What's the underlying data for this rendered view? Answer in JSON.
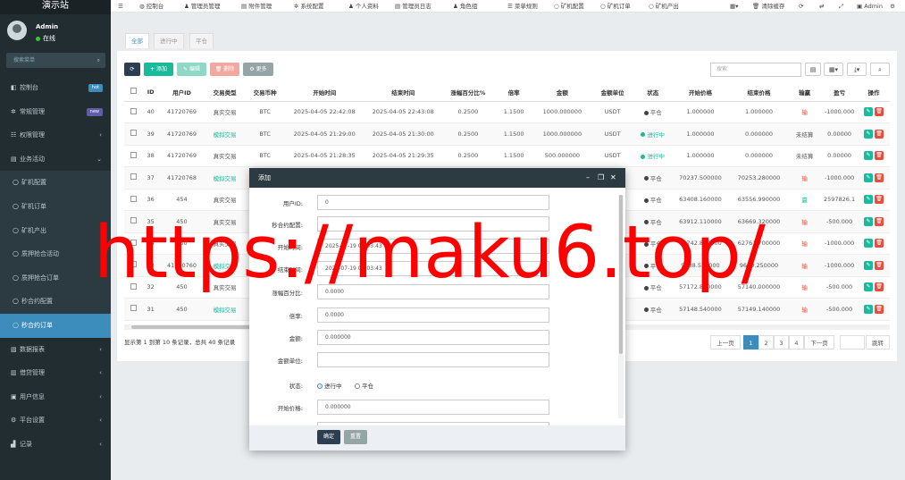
{
  "sidebar": {
    "brand": "演示站",
    "user": {
      "name": "Admin",
      "status": "在线"
    },
    "search_placeholder": "搜索菜单",
    "menu": [
      {
        "label": "控制台",
        "icon": "dashboard-icon",
        "badge": "hot"
      },
      {
        "label": "常规管理",
        "icon": "cog-icon",
        "badge": "new"
      },
      {
        "label": "权限管理",
        "icon": "group-icon",
        "chev": "‹"
      },
      {
        "label": "业务活动",
        "icon": "list-icon",
        "chev": "⌄"
      },
      {
        "label": "矿机配置",
        "icon": "circle-icon",
        "sub": true
      },
      {
        "label": "矿机订单",
        "icon": "circle-icon",
        "sub": true
      },
      {
        "label": "矿机产出",
        "icon": "circle-icon",
        "sub": true
      },
      {
        "label": "质押抢合活动",
        "icon": "circle-icon",
        "sub": true
      },
      {
        "label": "质押抢合订单",
        "icon": "circle-icon",
        "sub": true
      },
      {
        "label": "秒合约配置",
        "icon": "circle-icon",
        "sub": true
      },
      {
        "label": "秒合约订单",
        "icon": "circle-icon",
        "sub": true,
        "active": true
      },
      {
        "label": "数据报表",
        "icon": "file-icon",
        "chev": "‹"
      },
      {
        "label": "借贷管理",
        "icon": "table-icon",
        "chev": "‹"
      },
      {
        "label": "用户信息",
        "icon": "user-card-icon",
        "chev": "‹"
      },
      {
        "label": "平台设置",
        "icon": "gear-icon",
        "chev": "‹"
      },
      {
        "label": "记录",
        "icon": "chart-icon",
        "chev": "‹"
      }
    ]
  },
  "topbar": {
    "items": [
      "控制台",
      "管理员管理",
      "附件管理",
      "系统配置",
      "个人资料",
      "管理员日志",
      "角色组",
      "菜单规则",
      "矿机配置",
      "矿机订单",
      "矿机产出"
    ],
    "clear_cache": "清除缓存",
    "admin": "Admin"
  },
  "tabs": [
    {
      "label": "全部",
      "active": true
    },
    {
      "label": "进行中",
      "active": false
    },
    {
      "label": "平仓",
      "active": false
    }
  ],
  "toolbar": {
    "add": "添加",
    "edit": "编辑",
    "delete": "删除",
    "more": "更多",
    "search_placeholder": "搜索"
  },
  "table": {
    "headers": [
      "",
      "ID",
      "用户ID",
      "交易类型",
      "交易币种",
      "开始时间",
      "结束时间",
      "涨幅百分比%",
      "倍率",
      "金额",
      "金额单位",
      "状态",
      "开始价格",
      "结束价格",
      "输赢",
      "盈亏",
      "操作"
    ],
    "rows": [
      [
        "40",
        "41720769",
        "真实交易",
        "BTC",
        "2025-04-05 22:42:08",
        "2025-04-05 22:43:08",
        "0.2500",
        "1.1500",
        "1000.000000",
        "USDT",
        "平仓",
        "1.000000",
        "1.000000",
        "输",
        "-1000.000"
      ],
      [
        "39",
        "41720769",
        "模拟交易",
        "BTC",
        "2025-04-05 21:29:00",
        "2025-04-05 21:30:00",
        "0.2500",
        "1.1500",
        "1000.000000",
        "USDT",
        "进行中",
        "1.000000",
        "0.000000",
        "未结算",
        "0.00000"
      ],
      [
        "38",
        "41720769",
        "真实交易",
        "BTC",
        "2025-04-05 21:28:35",
        "2025-04-05 21:29:35",
        "0.2500",
        "1.1500",
        "500.000000",
        "USDT",
        "进行中",
        "1.000000",
        "0.000000",
        "未结算",
        "0.00000"
      ],
      [
        "37",
        "41720768",
        "模拟交易",
        "",
        "",
        "",
        "",
        "",
        "",
        "",
        "平仓",
        "70237.500000",
        "70253.280000",
        "输",
        "-1000.000"
      ],
      [
        "36",
        "454",
        "真实交易",
        "",
        "",
        "",
        "",
        "",
        "",
        "",
        "平仓",
        "63408.160000",
        "63556.990000",
        "赢",
        "2597826.1"
      ],
      [
        "35",
        "450",
        "真实交易",
        "",
        "",
        "",
        "",
        "",
        "",
        "",
        "平仓",
        "63912.110000",
        "63669.320000",
        "输",
        "-500.000"
      ],
      [
        "34",
        "450",
        "真实交易",
        "",
        "",
        "",
        "",
        "",
        "",
        "",
        "平仓",
        "62742.850000",
        "62761.700000",
        "输",
        "-1000.000"
      ],
      [
        "33",
        "41720760",
        "模拟交易",
        "",
        "",
        "",
        "",
        "",
        "",
        "",
        "平仓",
        "9688.550000",
        "9669.250000",
        "输",
        "-1000.000"
      ],
      [
        "32",
        "450",
        "真实交易",
        "",
        "",
        "",
        "",
        "",
        "",
        "",
        "平仓",
        "57172.800000",
        "57140.000000",
        "输",
        "-500.000"
      ],
      [
        "31",
        "450",
        "模拟交易",
        "",
        "",
        "",
        "",
        "",
        "",
        "",
        "平仓",
        "57148.540000",
        "57149.140000",
        "输",
        "-500.000"
      ]
    ]
  },
  "summary": "显示第 1 到第 10 条记录，总共 40 条记录",
  "pagination": {
    "prev": "上一页",
    "pages": [
      "1",
      "2",
      "3",
      "4"
    ],
    "next": "下一页",
    "jump": "跳转"
  },
  "modal": {
    "title": "添加",
    "fields": [
      {
        "label": "用户ID:",
        "value": "0"
      },
      {
        "label": "秒合约配置:",
        "value": ""
      },
      {
        "label": "开始时间:",
        "value": "2025-07-19 00:03:43"
      },
      {
        "label": "结束时间:",
        "value": "2025-07-19 00:03:43"
      },
      {
        "label": "涨幅百分比:",
        "value": "0.0000"
      },
      {
        "label": "倍率:",
        "value": "0.0000"
      },
      {
        "label": "金额:",
        "value": "0.000000"
      },
      {
        "label": "金额单位:",
        "value": ""
      }
    ],
    "status_label": "状态:",
    "status_options": [
      "进行中",
      "平仓"
    ],
    "start_price_label": "开始价格:",
    "start_price_value": "0.000000",
    "confirm": "确定",
    "reset": "重置"
  },
  "watermark": "https://maku6.top/"
}
